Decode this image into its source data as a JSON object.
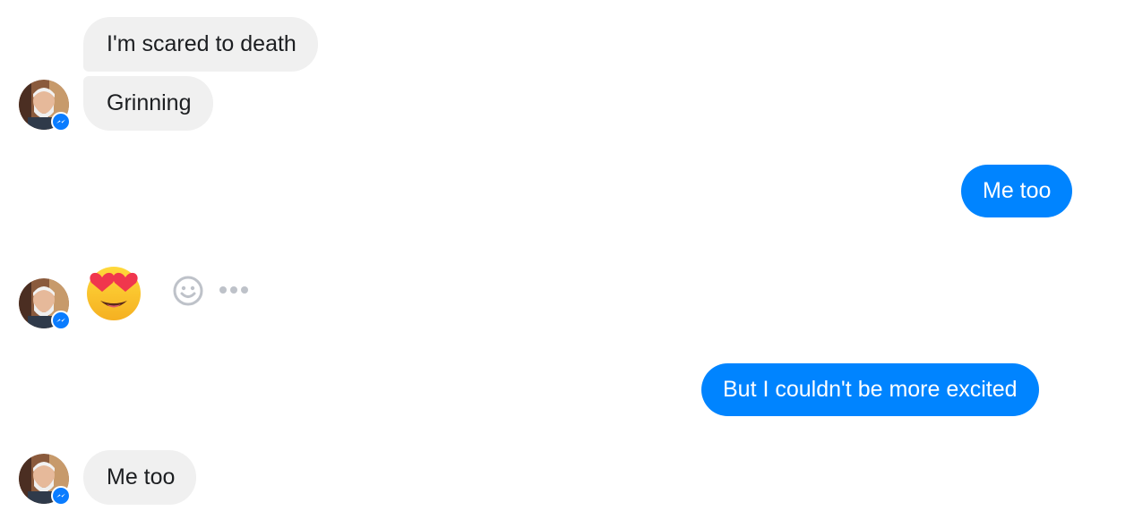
{
  "conversation": {
    "messages": [
      {
        "sender": "contact",
        "text": "I'm scared to death"
      },
      {
        "sender": "contact",
        "text": "Grinning"
      },
      {
        "sender": "self",
        "text": "Me too"
      },
      {
        "sender": "contact",
        "emoji": "smiling-face-with-heart-eyes"
      },
      {
        "sender": "self",
        "text": "But I couldn't be more excited"
      },
      {
        "sender": "contact",
        "text": "Me too"
      }
    ],
    "message_actions": {
      "react_icon": "smiley-react-icon",
      "more_icon": "more-options-icon"
    },
    "colors": {
      "outgoing_bubble": "#0084ff",
      "incoming_bubble": "#f0f0f0",
      "messenger_badge": "#0a7cff",
      "action_icon": "#bec2c9"
    }
  }
}
